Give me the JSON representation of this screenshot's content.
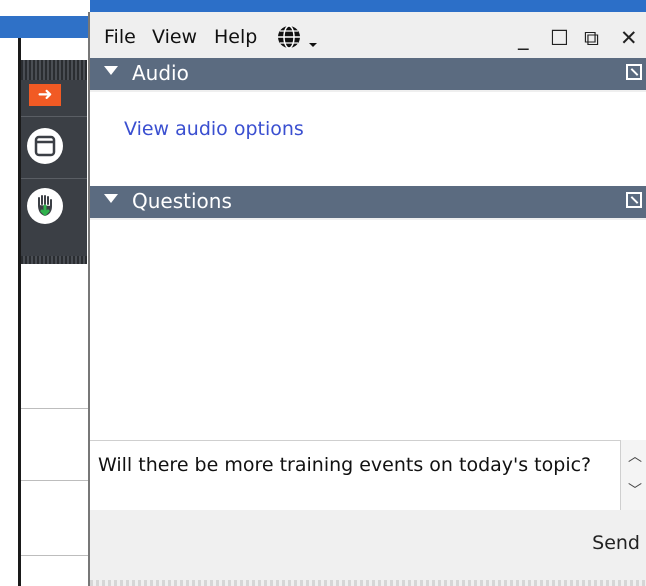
{
  "menubar": {
    "file": "File",
    "view": "View",
    "help": "Help"
  },
  "window_controls": {
    "minimize": "_",
    "maximize": "☐",
    "restore": "⧉",
    "close": "✕"
  },
  "audio_panel": {
    "title": "Audio",
    "link": "View audio options"
  },
  "questions_panel": {
    "title": "Questions",
    "input_value": "Will there be more training events on today's topic?"
  },
  "send_label": "Send",
  "toolbar": {
    "arrow_glyph": "➜"
  },
  "icons": [
    "globe-icon",
    "chevron-down-icon",
    "popout-icon",
    "arrow-right-icon",
    "window-icon",
    "raise-hand-icon",
    "scroll-up-icon",
    "scroll-down-icon"
  ],
  "colors": {
    "panel_header": "#5b6b80",
    "link": "#3a4fd0",
    "arrow_button": "#f15a24",
    "toolbar": "#3b3f45"
  }
}
